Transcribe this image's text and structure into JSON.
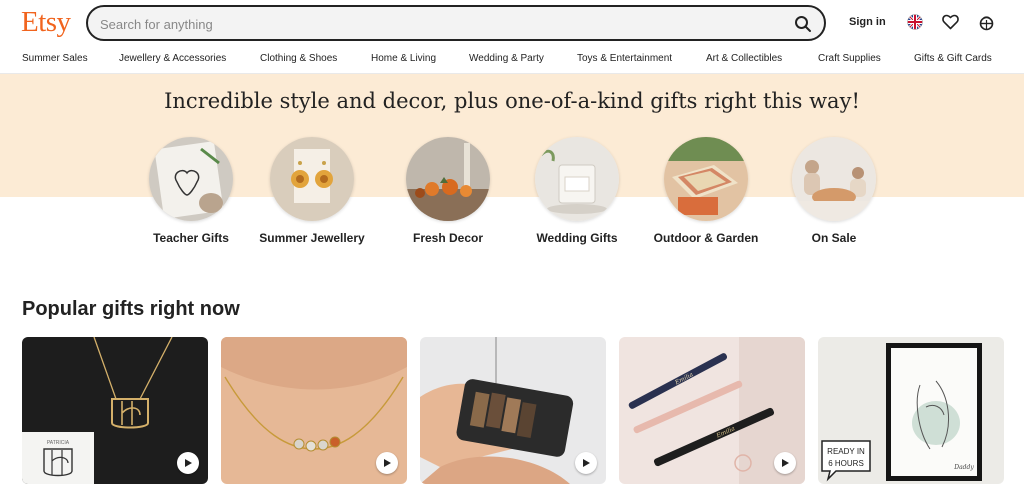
{
  "header": {
    "logo": "Etsy",
    "search": {
      "placeholder": "Search for anything",
      "value": ""
    },
    "sign_in": "Sign in",
    "icons": [
      "uk-flag-icon",
      "heart-icon",
      "basket-icon"
    ]
  },
  "nav": {
    "items": [
      "Summer Sales",
      "Jewellery & Accessories",
      "Clothing & Shoes",
      "Home & Living",
      "Wedding & Party",
      "Toys & Entertainment",
      "Art & Collectibles",
      "Craft Supplies",
      "Gifts & Gift Cards"
    ]
  },
  "hero": {
    "title": "Incredible style and decor, plus one-of-a-kind gifts right this way!",
    "categories": [
      {
        "label": "Teacher Gifts"
      },
      {
        "label": "Summer Jewellery"
      },
      {
        "label": "Fresh Decor"
      },
      {
        "label": "Wedding Gifts"
      },
      {
        "label": "Outdoor & Garden"
      },
      {
        "label": "On Sale"
      }
    ]
  },
  "popular": {
    "title": "Popular gifts right now",
    "cards": [
      {
        "name": "necklace-initials",
        "inset_text": "PATRICIA"
      },
      {
        "name": "birthstone-necklace"
      },
      {
        "name": "mini-photo-book"
      },
      {
        "name": "engraved-pens",
        "engraving_1": "Emilia",
        "engraving_2": "Emilia"
      },
      {
        "name": "line-art-print",
        "sticker_line1": "READY IN",
        "sticker_line2": "6 HOURS",
        "signature": "Daddy"
      }
    ]
  },
  "colors": {
    "brand": "#f1641e",
    "hero_background": "#fcebd5",
    "text": "#222222"
  }
}
